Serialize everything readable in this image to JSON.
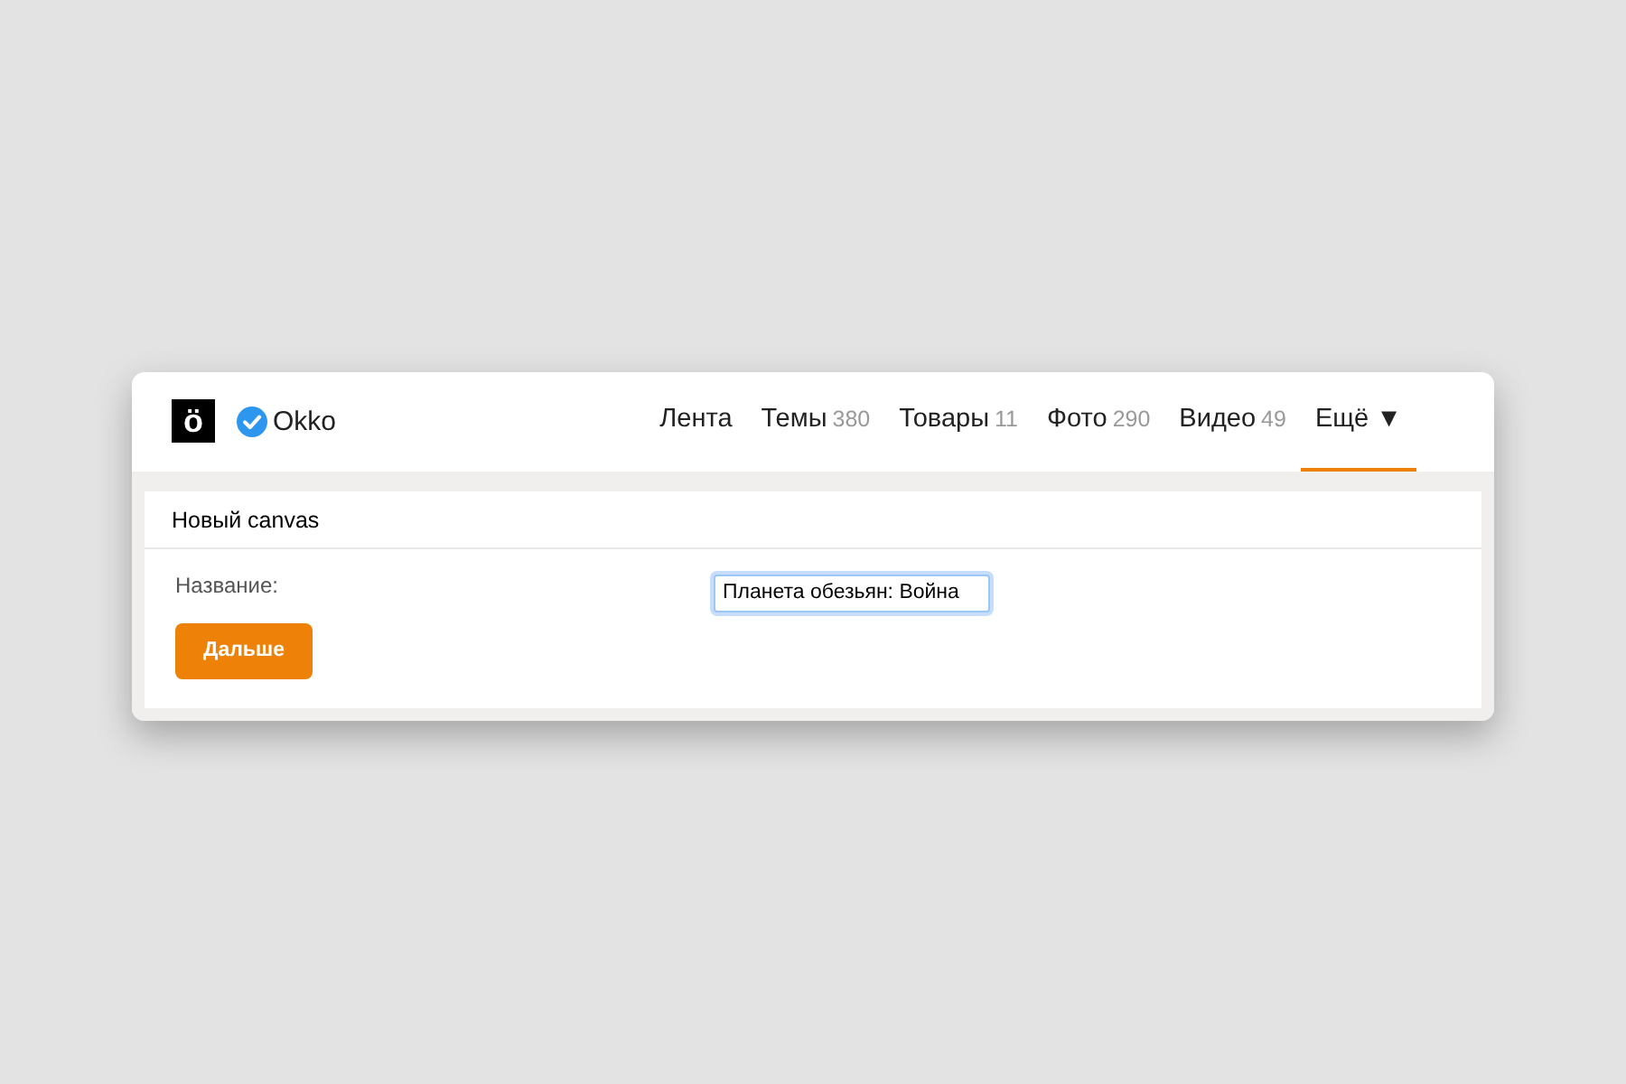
{
  "header": {
    "logo_letter": "ö",
    "account_name": "Okko",
    "verified": true
  },
  "tabs": [
    {
      "label": "Лента",
      "selected": false
    },
    {
      "label": "Темы",
      "count": "380",
      "selected": false
    },
    {
      "label": "Товары",
      "count": "11",
      "selected": false
    },
    {
      "label": "Фото",
      "count": "290",
      "selected": false
    },
    {
      "label": "Видео",
      "count": "49",
      "selected": false
    },
    {
      "label": "Ещё ▼",
      "selected": true
    }
  ],
  "panel": {
    "title": "Новый canvas",
    "field_label": "Название:",
    "field_value": "Планета обезьян: Война",
    "button": "Дальше"
  }
}
